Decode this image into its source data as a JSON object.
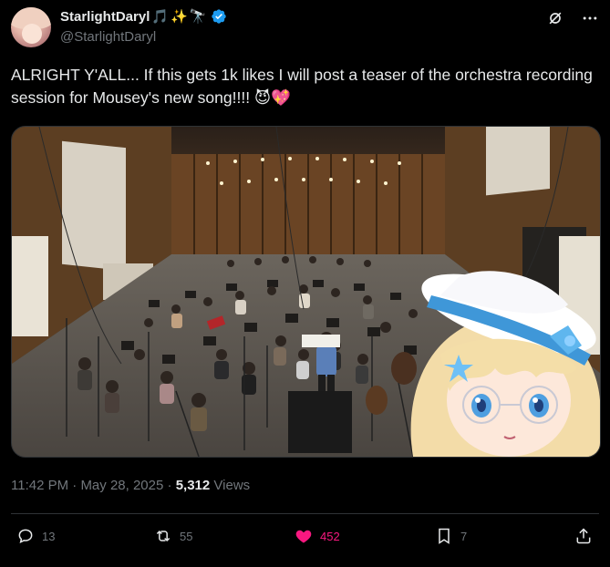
{
  "author": {
    "display_name": "StarlightDaryl",
    "name_emojis": [
      "🎵",
      "✨",
      "🔭"
    ],
    "handle": "@StarlightDaryl",
    "verified": true
  },
  "icons": {
    "grok": "grok-icon",
    "more": "more-icon",
    "reply": "reply-icon",
    "retweet": "retweet-icon",
    "like": "heart-icon",
    "bookmark": "bookmark-icon",
    "share": "share-icon"
  },
  "tweet": {
    "text": "ALRIGHT Y'ALL... If this gets 1k likes I will post a teaser of the orchestra recording session for Mousey's new song!!!! 😈💖"
  },
  "meta": {
    "time": "11:42 PM",
    "separator": " · ",
    "date": "May 28, 2025",
    "views_count": "5,312",
    "views_label": "Views"
  },
  "actions": {
    "replies": "13",
    "reposts": "55",
    "likes": "452",
    "bookmarks": "7"
  },
  "colors": {
    "background": "#000000",
    "text": "#e7e9ea",
    "secondary": "#71767b",
    "like": "#f91880",
    "verified": "#1d9bf0",
    "divider": "#2f3336"
  }
}
